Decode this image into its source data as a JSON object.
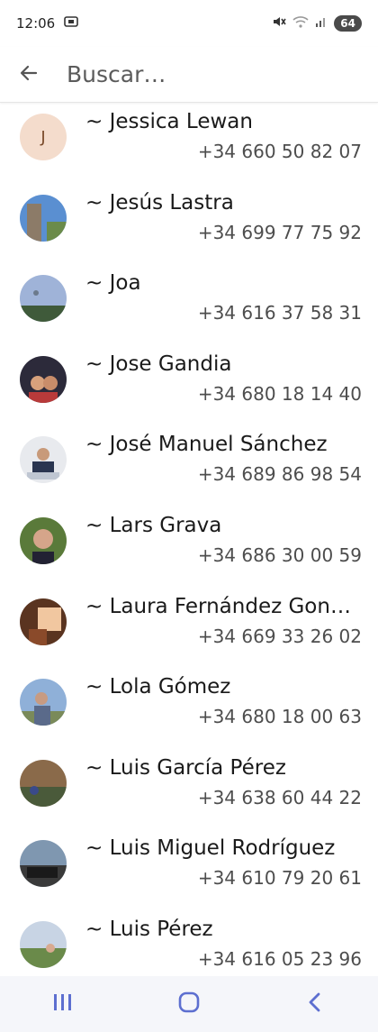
{
  "status": {
    "time": "12:06",
    "battery": "64"
  },
  "search": {
    "placeholder": "Buscar…",
    "back_label": "back"
  },
  "contacts": [
    {
      "name": "~ Jessica Lewan",
      "phone": "+34 660 50 82 07",
      "initial": "J"
    },
    {
      "name": "~ Jesús Lastra",
      "phone": "+34 699 77 75 92"
    },
    {
      "name": "~ Joa",
      "phone": "+34 616 37 58 31"
    },
    {
      "name": "~ Jose Gandia",
      "phone": "+34 680 18 14 40"
    },
    {
      "name": "~ José Manuel Sánchez",
      "phone": "+34 689 86 98 54"
    },
    {
      "name": "~ Lars Grava",
      "phone": "+34 686 30 00 59"
    },
    {
      "name": "~ Laura Fernández Gon…",
      "phone": "+34 669 33 26 02"
    },
    {
      "name": "~ Lola Gómez",
      "phone": "+34 680 18 00 63"
    },
    {
      "name": "~ Luis García Pérez",
      "phone": "+34 638 60 44 22"
    },
    {
      "name": "~ Luis Miguel Rodríguez",
      "phone": "+34 610 79 20 61"
    },
    {
      "name": "~ Luis Pérez",
      "phone": "+34 616 05 23 96"
    }
  ]
}
